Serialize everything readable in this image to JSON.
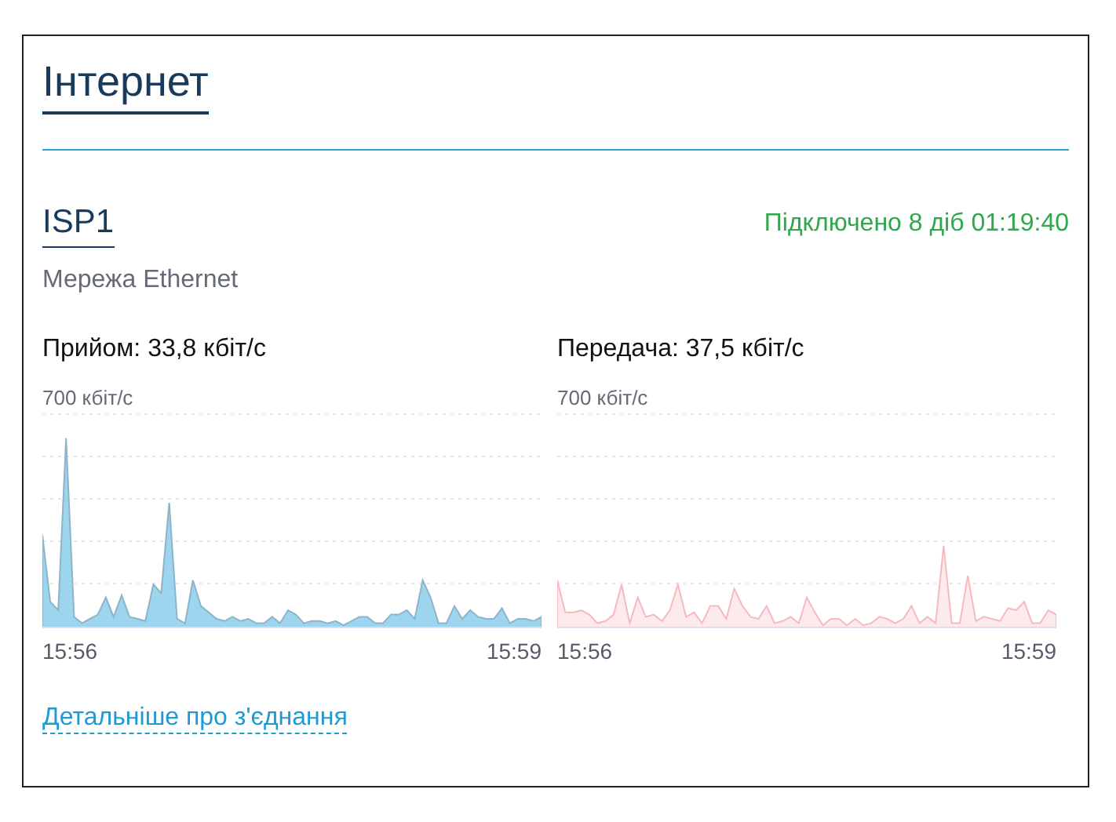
{
  "title": "Інтернет",
  "connection": {
    "name": "ISP1",
    "status": "Підключено 8 діб 01:19:40",
    "type": "Мережа Ethernet"
  },
  "graphs": [
    {
      "kind": "receive",
      "label": "Прийом: 33,8 кбіт/с",
      "scale": "700 кбіт/с",
      "x_start": "15:56",
      "x_end": "15:59"
    },
    {
      "kind": "transmit",
      "label": "Передача: 37,5 кбіт/с",
      "scale": "700 кбіт/с",
      "x_start": "15:56",
      "x_end": "15:59"
    }
  ],
  "details_link": "Детальніше про з'єднання"
}
